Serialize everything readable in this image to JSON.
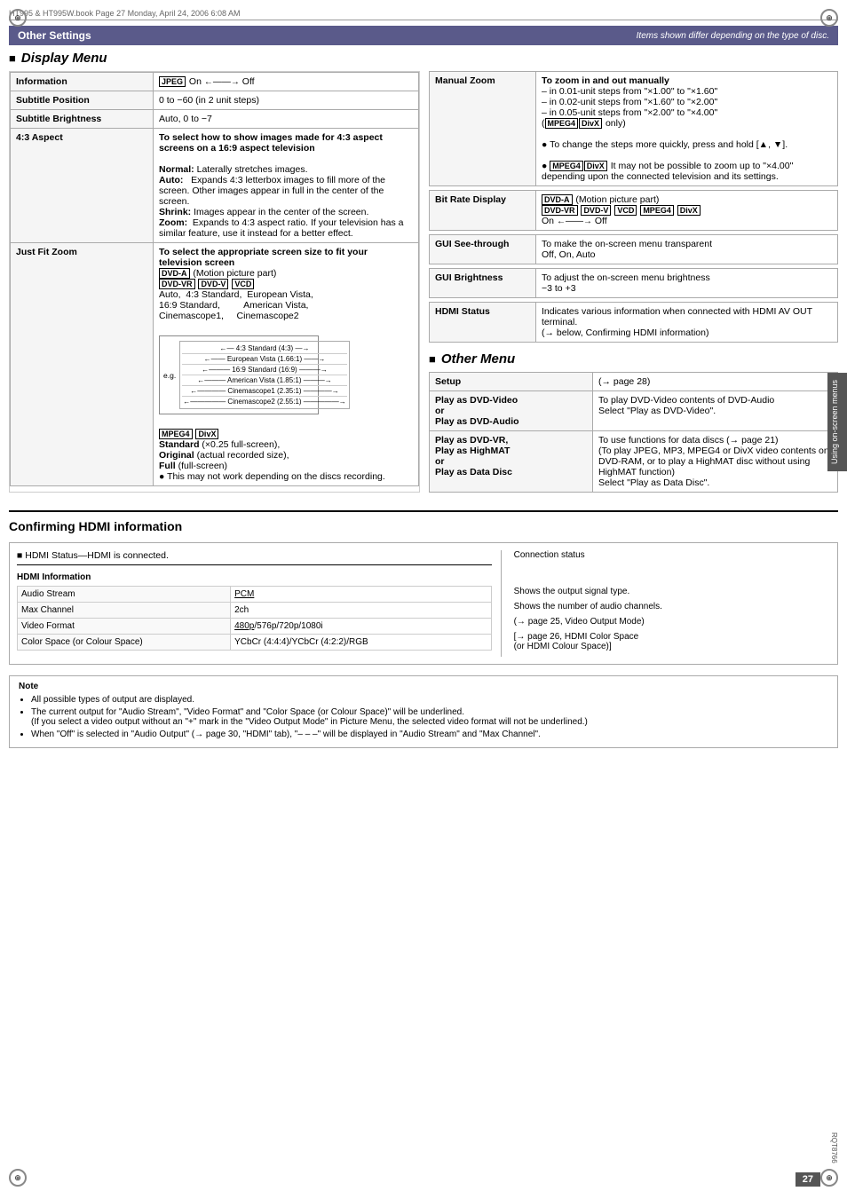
{
  "page": {
    "number": "27",
    "rqt": "RQT8766",
    "file_info": "HT995 & HT995W.book   Page 27   Monday, April 24, 2006   6:08 AM"
  },
  "header": {
    "title": "Other Settings",
    "subtitle": "Items shown differ depending on the type of disc."
  },
  "display_menu": {
    "title": "Display Menu",
    "rows": [
      {
        "label": "Information",
        "content": "JPEG  On ←——→ Off"
      },
      {
        "label": "Subtitle Position",
        "content": "0 to −60 (in 2 unit steps)"
      },
      {
        "label": "Subtitle Brightness",
        "content": "Auto, 0 to −7"
      },
      {
        "label": "4:3 Aspect",
        "content": "To select how to show images made for 4:3 aspect screens on a 16:9 aspect television\n\nNormal: Laterally stretches images.\nAuto:    Expands 4:3 letterbox images to fill more of the screen. Other images appear in full in the center of the screen.\nShrink:  Images appear in the center of the screen.\nZoom:   Expands to 4:3 aspect ratio. If your television has a similar feature, use it instead for a better effect."
      },
      {
        "label": "Just Fit Zoom",
        "content": "To select the appropriate screen size to fit your television screen\n\nDVD-A (Motion picture part)\nDVD-VR  DVD-V  VCD\nAuto,  4:3 Standard,  European Vista,\n16:9 Standard,         American Vista,\nCinemascope1,     Cinemascope2\n\nMPEG4  DivX\nStandard (×0.25 full-screen),\nOriginal (actual recorded size),\nFull (full-screen)\n● This may not work depending on the discs recording."
      }
    ]
  },
  "right_column": {
    "manual_zoom": {
      "label": "Manual Zoom",
      "content": [
        "To zoom in and out manually",
        "– in 0.01-unit steps from \"×1.00\" to \"×1.60\"",
        "– in 0.02-unit steps from \"×1.60\" to \"×2.00\"",
        "– in 0.05-unit steps from \"×2.00\" to \"×4.00\"",
        "(MPEG4  DivX only)",
        "● To change the steps more quickly, press and hold [▲, ▼].",
        "● MPEG4  DivX  It may not be possible to zoom up to \"×4.00\" depending upon the connected television and its settings."
      ]
    },
    "bit_rate": {
      "label": "Bit Rate Display",
      "content": "DVD-A (Motion picture part)\nDVD-VR  DVD-V  VCD  MPEG4  DivX\nOn ←——→ Off"
    },
    "gui_seethrough": {
      "label": "GUI See-through",
      "content": "To make the on-screen menu transparent\nOff, On, Auto"
    },
    "gui_brightness": {
      "label": "GUI Brightness",
      "content": "To adjust the on-screen menu brightness\n−3 to +3"
    },
    "hdmi_status": {
      "label": "HDMI Status",
      "content": "Indicates various information when connected with HDMI AV OUT terminal.\n(→ below, Confirming HDMI information)"
    }
  },
  "other_menu": {
    "title": "Other Menu",
    "rows": [
      {
        "label": "Setup",
        "content": "(→ page 28)"
      },
      {
        "label": "Play as DVD-Video\nor\nPlay as DVD-Audio",
        "content": "To play DVD-Video contents of DVD-Audio\nSelect \"Play as DVD-Video\"."
      },
      {
        "label": "Play as DVD-VR,\nPlay as HighMAT\nor\nPlay as Data Disc",
        "content": "To use functions for data discs (→ page 21)\n(To play JPEG, MP3, MPEG4 or DivX video contents on DVD-RAM, or to play a HighMAT disc without using HighMAT function)\nSelect \"Play as Data Disc\"."
      }
    ]
  },
  "sidebar": {
    "label": "Using on-screen menus"
  },
  "hdmi_section": {
    "title": "Confirming HDMI information",
    "status_line": "■ HDMI Status—HDMI is connected.",
    "connection_status": "Connection status",
    "info_label": "HDMI Information",
    "table_rows": [
      {
        "label": "Audio Stream",
        "value": "PCM",
        "note": "Shows the output signal type."
      },
      {
        "label": "Max Channel",
        "value": "2ch",
        "note": "Shows the number of audio channels."
      },
      {
        "label": "Video Format",
        "value": "480p/576p/720p/1080i",
        "note": "(→ page 25, Video Output Mode)"
      },
      {
        "label": "Color Space (or Colour Space)",
        "value": "YCbCr (4:4:4)/YCbCr (4:2:2)/RGB",
        "note": "[→ page 26, HDMI Color Space\n(or HDMI Colour Space)]"
      }
    ]
  },
  "note": {
    "title": "Note",
    "items": [
      "All possible types of output are displayed.",
      "The current output for \"Audio Stream\", \"Video Format\" and \"Color Space (or Colour Space)\" will be underlined.\n(If you select a video output without an \"+\" mark in the \"Video Output Mode\" in Picture Menu, the selected video format will not be underlined.)",
      "When \"Off\" is selected in \"Audio Output\" (→ page 30, \"HDMI\" tab), \"– – –\" will be displayed in \"Audio Stream\" and \"Max Channel\"."
    ]
  }
}
